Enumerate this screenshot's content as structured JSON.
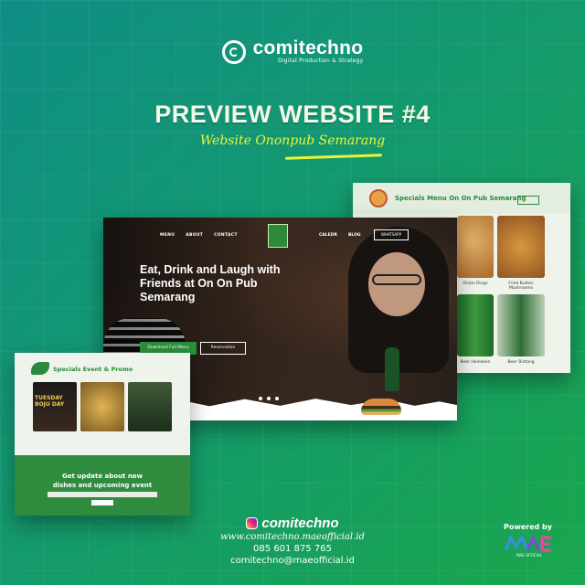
{
  "brand": {
    "name": "comitechno",
    "tagline": "Digital Production & Strategy"
  },
  "headline": "PREVIEW WEBSITE #4",
  "subtitle": "Website Ononpub Semarang",
  "menu_card": {
    "title": "Specials Menu On On Pub Semarang",
    "labels": [
      "Onion Rings",
      "Fried Button Mushrooms",
      "Beer Heineken",
      "Beer Bintang"
    ]
  },
  "hero": {
    "nav_left": [
      "MENU",
      "ABOUT",
      "CONTACT"
    ],
    "nav_right": [
      "CALEDR",
      "BLOG"
    ],
    "whatsapp": "WHATSAPP",
    "heading": "Eat, Drink and Laugh with Friends at On On Pub Semarang",
    "button_primary": "Download Full Menu",
    "button_secondary": "Reservation"
  },
  "event_card": {
    "title": "Specials Event & Promo",
    "poster_text": "TUESDAY BOJU DAY",
    "cta": "Get update about new dishes and upcoming event"
  },
  "footer": {
    "instagram": "comitechno",
    "website": "www.comitechno.maeofficial.id",
    "phone": "085 601 875 765",
    "email": "comitechno@maeofficial.id",
    "powered_by": "Powered by",
    "partner": "MAE OFFICIAL"
  },
  "colors": {
    "accent_yellow": "#e8f53a",
    "brand_green": "#2b8a3e"
  }
}
